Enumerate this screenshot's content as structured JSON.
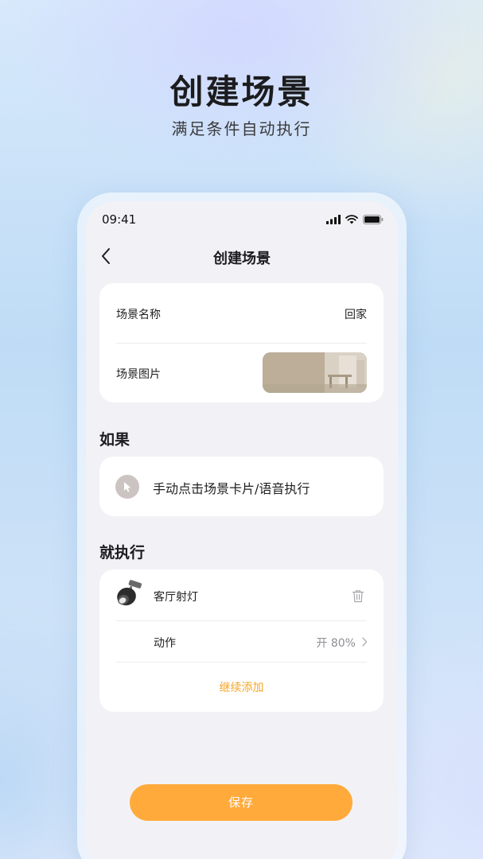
{
  "hero": {
    "title": "创建场景",
    "subtitle": "满足条件自动执行"
  },
  "status_bar": {
    "time": "09:41",
    "icons": [
      "signal-icon",
      "wifi-icon",
      "battery-icon"
    ]
  },
  "nav": {
    "back_icon": "chevron-left-icon",
    "title": "创建场景"
  },
  "scene_info": {
    "name_label": "场景名称",
    "name_value": "回家",
    "image_label": "场景图片"
  },
  "condition": {
    "heading": "如果",
    "icon": "cursor-click-icon",
    "text": "手动点击场景卡片/语音执行"
  },
  "action": {
    "heading": "就执行",
    "device_icon": "spotlight-icon",
    "device_name": "客厅射灯",
    "delete_icon": "trash-icon",
    "action_label": "动作",
    "action_value": "开 80%",
    "chevron_icon": "chevron-right-icon",
    "add_more": "继续添加"
  },
  "save_label": "保存",
  "colors": {
    "accent": "#ffaa3b",
    "add_more": "#f5a623",
    "screen_bg": "#f2f2f6",
    "card_bg": "#ffffff"
  }
}
